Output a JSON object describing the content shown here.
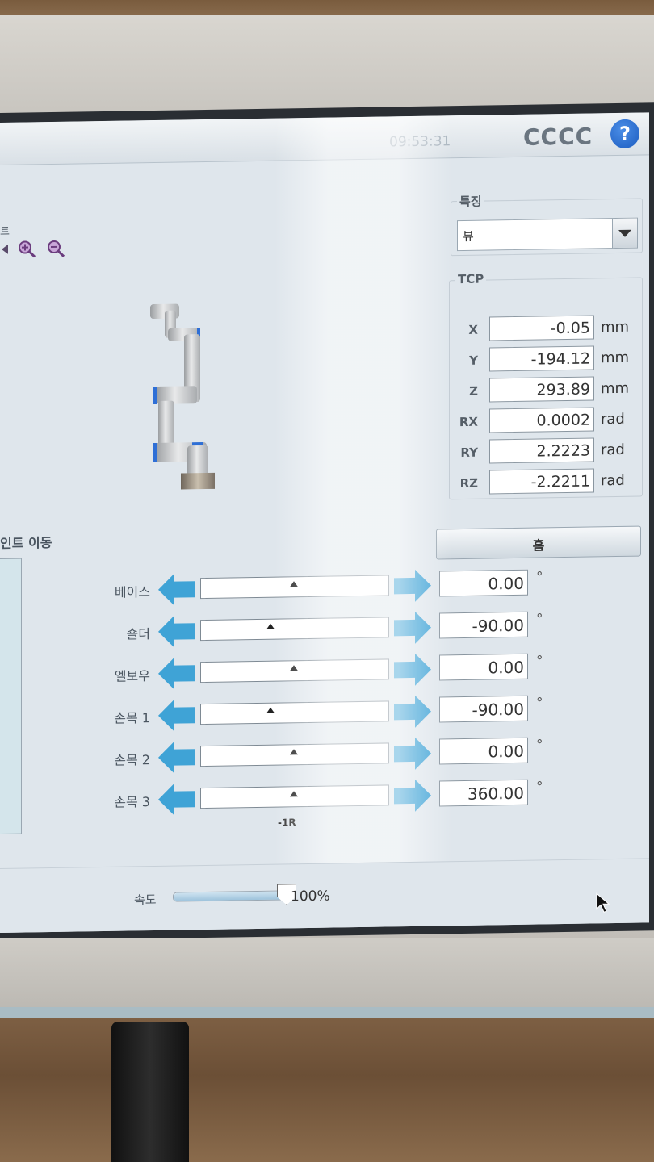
{
  "topbar": {
    "clock": "09:53:31",
    "robot_name": "CCCC",
    "help_icon": "?"
  },
  "view": {
    "tab_fragment": "트",
    "zoom_in_icon": "zoom-in-icon",
    "zoom_out_icon": "zoom-out-icon"
  },
  "feature": {
    "label": "특징",
    "selected": "뷰"
  },
  "tcp": {
    "label": "TCP",
    "rows": [
      {
        "label": "X",
        "value": "-0.05",
        "unit": "mm"
      },
      {
        "label": "Y",
        "value": "-194.12",
        "unit": "mm"
      },
      {
        "label": "Z",
        "value": "293.89",
        "unit": "mm"
      },
      {
        "label": "RX",
        "value": "0.0002",
        "unit": "rad"
      },
      {
        "label": "RY",
        "value": "2.2223",
        "unit": "rad"
      },
      {
        "label": "RZ",
        "value": "-2.2211",
        "unit": "rad"
      }
    ]
  },
  "joint_move": {
    "title": "인트 이동",
    "home_label": "홈",
    "degree_unit": "°",
    "scale_label": "-1R",
    "joints": [
      {
        "label": "베이스",
        "value": "0.00",
        "position": 0.5
      },
      {
        "label": "숄더",
        "value": "-90.00",
        "position": 0.375
      },
      {
        "label": "엘보우",
        "value": "0.00",
        "position": 0.5
      },
      {
        "label": "손목 1",
        "value": "-90.00",
        "position": 0.375
      },
      {
        "label": "손목 2",
        "value": "0.00",
        "position": 0.5
      },
      {
        "label": "손목 3",
        "value": "360.00",
        "position": 0.5
      }
    ]
  },
  "speed": {
    "label": "속도",
    "value": "100%",
    "level": 1.0
  },
  "colors": {
    "accent_blue": "#2e6fd6",
    "arrow_blue": "#3fa3d6",
    "panel_bg": "#dfe6ec"
  }
}
